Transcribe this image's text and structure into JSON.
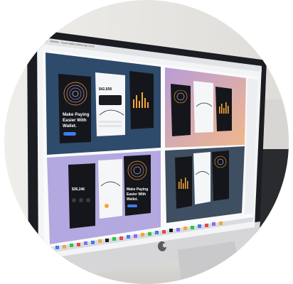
{
  "scene": {
    "background_color": "#ffffff",
    "monitor_bezel_color": "#1c1d22",
    "wall_color": "#e8e6e2",
    "stand_color": "#c9c9cc"
  },
  "browser": {
    "tab_title": "Dribbble - Crypto Wallet Mobile App UI Kit"
  },
  "shots": [
    {
      "id": "dark-navy",
      "bg": "#2e4b6b",
      "headline_lines": [
        "Make Paying",
        "Easier With",
        "Wallet."
      ],
      "button_label": "",
      "balance": "$42,658"
    },
    {
      "id": "peach-purple",
      "bg_from": "#b89cd8",
      "bg_to": "#f0b890"
    },
    {
      "id": "lavender",
      "bg": "#b3a8df",
      "headline_lines": [
        "Make Paying",
        "Easier With",
        "Wallet."
      ],
      "balance": "$36,246"
    },
    {
      "id": "slate",
      "bg": "#3e4f62"
    }
  ],
  "accent_colors": {
    "orange": "#f4a63a",
    "blue": "#3f7cf0",
    "dark_phone": "#1a1b20",
    "light_phone": "#f5f6f8"
  },
  "brand": {
    "logo_icon": "apple-logo-icon"
  }
}
